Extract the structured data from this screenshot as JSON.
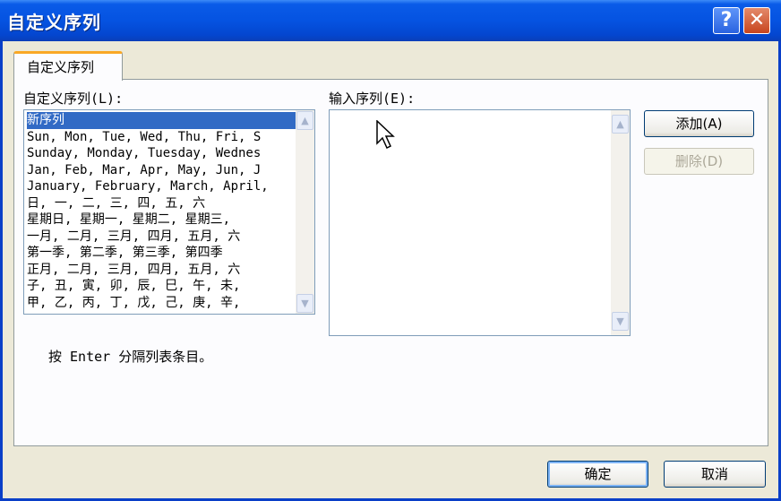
{
  "window": {
    "title": "自定义序列"
  },
  "titlebar_buttons": {
    "help": "?",
    "close": "✕"
  },
  "tab": {
    "label": "自定义序列"
  },
  "list_label": "自定义序列(L):",
  "input_label": "输入序列(E):",
  "list_items": [
    "新序列",
    "Sun, Mon, Tue, Wed, Thu, Fri, S",
    "Sunday, Monday, Tuesday, Wednes",
    "Jan, Feb, Mar, Apr, May, Jun, J",
    "January, February, March, April,",
    "日, 一, 二, 三, 四, 五, 六",
    "星期日, 星期一, 星期二, 星期三,",
    "一月, 二月, 三月, 四月, 五月, 六",
    "第一季, 第二季, 第三季, 第四季",
    "正月, 二月, 三月, 四月, 五月, 六",
    "子, 丑, 寅, 卯, 辰, 巳, 午, 未,",
    "甲, 乙, 丙, 丁, 戊, 己, 庚, 辛,"
  ],
  "selected_index": 0,
  "input_value": "",
  "buttons": {
    "add": "添加(A)",
    "delete": "删除(D)",
    "ok": "确定",
    "cancel": "取消"
  },
  "hint": "按 Enter 分隔列表条目。",
  "scroll_arrows": {
    "up": "▲",
    "down": "▼"
  },
  "colors": {
    "titlebar": "#0553E1",
    "selection": "#316AC5",
    "tab_accent": "#F9A825"
  }
}
